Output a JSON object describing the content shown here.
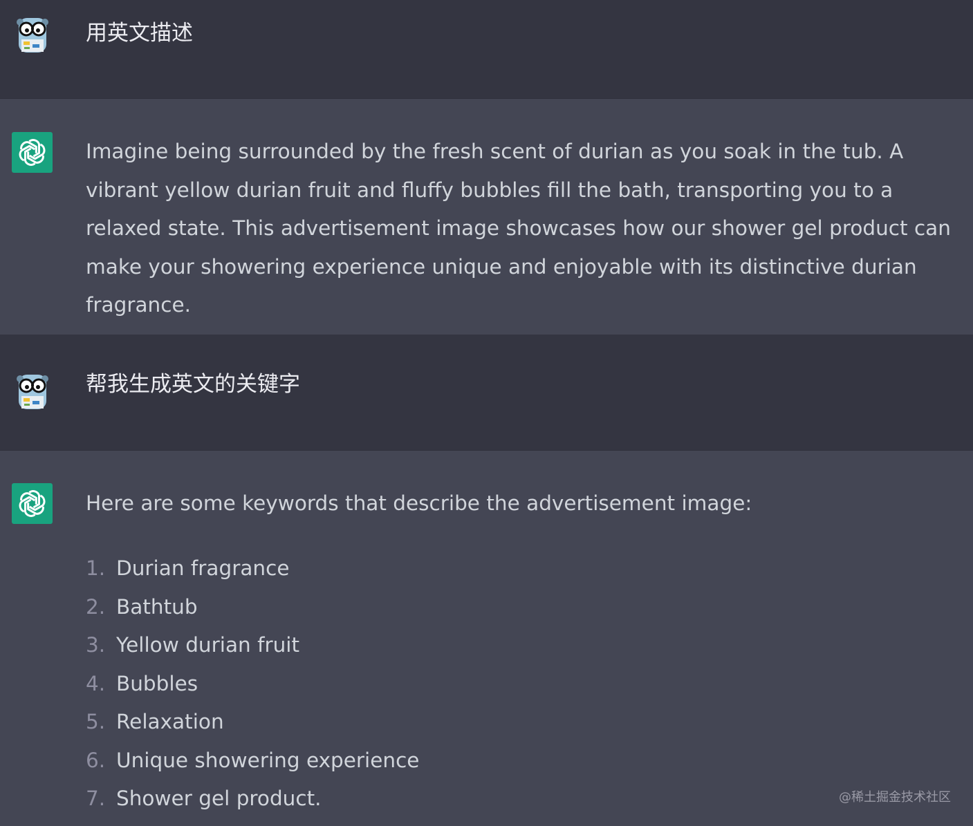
{
  "conversation": {
    "messages": [
      {
        "role": "user",
        "text": "用英文描述"
      },
      {
        "role": "assistant",
        "text": "Imagine being surrounded by the fresh scent of durian as you soak in the tub. A vibrant yellow durian fruit and fluffy bubbles fill the bath, transporting you to a relaxed state. This advertisement image showcases how our shower gel product can make your showering experience unique and enjoyable with its distinctive durian fragrance."
      },
      {
        "role": "user",
        "text": "帮我生成英文的关键字"
      },
      {
        "role": "assistant",
        "intro": "Here are some keywords that describe the advertisement image:",
        "items": [
          {
            "num": "1.",
            "text": "Durian fragrance"
          },
          {
            "num": "2.",
            "text": "Bathtub"
          },
          {
            "num": "3.",
            "text": "Yellow durian fruit"
          },
          {
            "num": "4.",
            "text": "Bubbles"
          },
          {
            "num": "5.",
            "text": "Relaxation"
          },
          {
            "num": "6.",
            "text": "Unique showering experience"
          },
          {
            "num": "7.",
            "text": "Shower gel product."
          }
        ]
      }
    ]
  },
  "watermark": "@稀土掘金技术社区",
  "colors": {
    "user_bg": "#343541",
    "assistant_bg": "#444654",
    "bot_avatar": "#19a37f",
    "text": "#d1d5db"
  },
  "icons": {
    "user_avatar": "gopher-avatar-icon",
    "bot_avatar": "openai-logo-icon"
  }
}
